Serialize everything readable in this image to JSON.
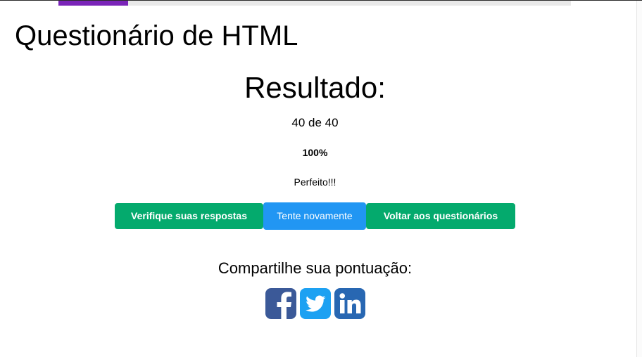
{
  "quiz": {
    "title": "Questionário de HTML",
    "progress": 0.136
  },
  "result": {
    "heading": "Resultado:",
    "score": "40 de 40",
    "percent": "100%",
    "comment": "Perfeito!!!"
  },
  "actions": {
    "check_answers": "Verifique suas respostas",
    "try_again": "Tente novamente",
    "back_to_quizzes": "Voltar aos questionários"
  },
  "share": {
    "heading": "Compartilhe sua pontuação:",
    "icons": [
      "facebook-icon",
      "twitter-icon",
      "linkedin-icon"
    ]
  },
  "colors": {
    "progress": "#7a24b8",
    "green": "#04aa6d",
    "blue": "#2196f3",
    "facebook": "#3b5998",
    "twitter": "#1da1f2",
    "linkedin": "#2867b2"
  }
}
